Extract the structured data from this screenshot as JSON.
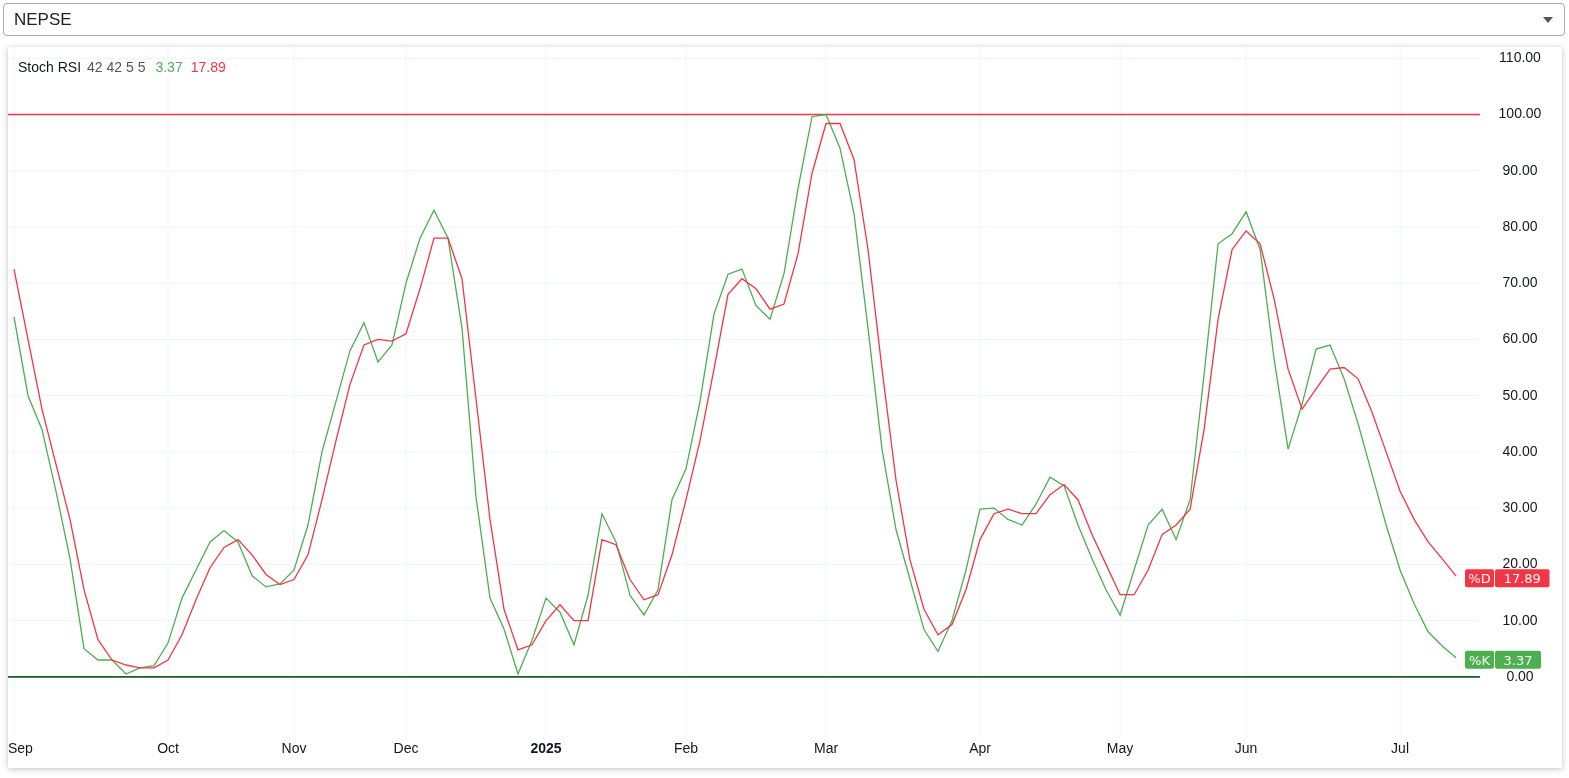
{
  "symbol_select": {
    "value": "NEPSE"
  },
  "indicator": {
    "legend": {
      "title": "Stoch RSI",
      "params": "42 42 5 5",
      "values": [
        {
          "text": "3.37",
          "color": "#4caf50"
        },
        {
          "text": "17.89",
          "color": "#f23645"
        }
      ]
    },
    "chart_data": {
      "type": "line",
      "ylim": [
        -10.7,
        112
      ],
      "categories": [
        "Sep",
        null,
        null,
        null,
        null,
        null,
        null,
        null,
        null,
        null,
        null,
        "Oct",
        null,
        null,
        null,
        null,
        null,
        null,
        null,
        null,
        "Nov",
        null,
        null,
        null,
        null,
        null,
        null,
        null,
        "Dec",
        null,
        null,
        null,
        null,
        null,
        null,
        null,
        null,
        null,
        "2025",
        null,
        null,
        null,
        null,
        null,
        null,
        null,
        null,
        null,
        "Feb",
        null,
        null,
        null,
        null,
        null,
        null,
        null,
        null,
        null,
        "Mar",
        null,
        null,
        null,
        null,
        null,
        null,
        null,
        null,
        null,
        null,
        "Apr",
        null,
        null,
        null,
        null,
        null,
        null,
        null,
        null,
        null,
        "May",
        null,
        null,
        null,
        null,
        null,
        null,
        null,
        null,
        "Jun",
        null,
        null,
        null,
        null,
        null,
        null,
        null,
        null,
        null,
        null,
        "Jul",
        null,
        null,
        null,
        null
      ],
      "series": [
        {
          "name": "%K",
          "color": "#4caf50",
          "values": [
            64,
            50,
            44,
            33,
            21,
            5,
            3,
            3,
            0.5,
            1.6,
            2,
            6,
            14,
            19,
            24,
            26,
            24,
            18,
            16,
            16.5,
            19,
            27,
            40,
            49,
            58,
            63,
            56,
            59,
            70,
            78,
            83,
            78,
            62,
            32,
            14,
            8.5,
            0.5,
            6.5,
            14,
            11.5,
            5.7,
            14.5,
            29,
            24,
            14.5,
            11,
            15.5,
            31.5,
            37,
            49,
            64.5,
            71.6,
            72.5,
            66,
            63.6,
            71.7,
            86.8,
            99.6,
            100,
            94,
            82.4,
            62,
            40.5,
            26.2,
            17.3,
            8.4,
            4.5,
            10,
            19,
            29.8,
            30,
            28,
            27,
            30.7,
            35.5,
            34,
            27,
            21,
            15.5,
            11,
            19,
            27,
            29.8,
            24.4,
            31.5,
            53.8,
            77,
            78.8,
            82.7,
            76,
            56.5,
            40.5,
            48.5,
            58.3,
            59,
            53,
            45,
            36,
            27,
            19,
            13,
            8,
            5.5,
            3.4
          ]
        },
        {
          "name": "%D",
          "color": "#f23645",
          "values": [
            72.5,
            60,
            47.6,
            37.8,
            28,
            15.5,
            6.6,
            3,
            2.1,
            1.6,
            1.6,
            3,
            7.5,
            13.7,
            19.4,
            23,
            24.4,
            21.7,
            18.2,
            16.4,
            17.3,
            21.7,
            31.5,
            42,
            52,
            59,
            60,
            59.7,
            61,
            69,
            78,
            78,
            70.8,
            49.4,
            28,
            12,
            4.8,
            5.7,
            10,
            12.8,
            10,
            10,
            24.4,
            23.5,
            17.3,
            13.7,
            14.6,
            21.7,
            31.5,
            42,
            54.7,
            68,
            70.8,
            69,
            65.4,
            66.3,
            75.2,
            89.5,
            98.4,
            98.4,
            92,
            76,
            54.7,
            35,
            20.8,
            12,
            7.5,
            9.3,
            15.5,
            24.4,
            29,
            29.8,
            29,
            29,
            32.4,
            34.2,
            31.5,
            25.3,
            20,
            14.6,
            14.6,
            19,
            25.3,
            27,
            29.8,
            44,
            63.6,
            76,
            79.3,
            77,
            67.2,
            54.7,
            47.6,
            51.2,
            54.7,
            55,
            53,
            47,
            40,
            33,
            28,
            24,
            21,
            17.9
          ]
        }
      ],
      "yticks": [
        {
          "value": 0,
          "label": "0.00"
        },
        {
          "value": 10,
          "label": "10.00"
        },
        {
          "value": 20,
          "label": "20.00"
        },
        {
          "value": 30,
          "label": "30.00"
        },
        {
          "value": 40,
          "label": "40.00"
        },
        {
          "value": 50,
          "label": "50.00"
        },
        {
          "value": 60,
          "label": "60.00"
        },
        {
          "value": 70,
          "label": "70.00"
        },
        {
          "value": 80,
          "label": "80.00"
        },
        {
          "value": 90,
          "label": "90.00"
        },
        {
          "value": 100,
          "label": "100.00"
        },
        {
          "value": 110,
          "label": "110.00"
        }
      ],
      "ref_lines": [
        {
          "axis": "y",
          "value": 100,
          "color": "#f23645"
        },
        {
          "axis": "y",
          "value": 0,
          "color": "#1b5e20"
        }
      ],
      "grid": true,
      "legend": true,
      "value_labels": [
        "3.37",
        "17.89"
      ]
    }
  }
}
